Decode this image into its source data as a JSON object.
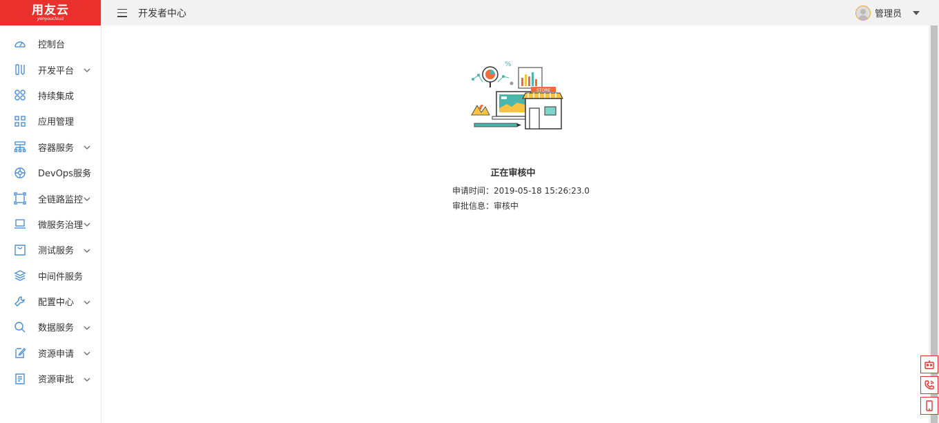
{
  "logo": {
    "main": "用友云",
    "sub": "yonyoucloud"
  },
  "header": {
    "title": "开发者中心",
    "user_name": "管理员"
  },
  "sidebar": {
    "items": [
      {
        "label": "控制台",
        "icon": "dashboard-icon",
        "expandable": false
      },
      {
        "label": "开发平台",
        "icon": "dev-platform-icon",
        "expandable": true
      },
      {
        "label": "持续集成",
        "icon": "integration-icon",
        "expandable": false
      },
      {
        "label": "应用管理",
        "icon": "apps-grid-icon",
        "expandable": false
      },
      {
        "label": "容器服务",
        "icon": "container-tree-icon",
        "expandable": true
      },
      {
        "label": "DevOps服务",
        "icon": "devops-icon",
        "expandable": true
      },
      {
        "label": "全链路监控",
        "icon": "monitor-frame-icon",
        "expandable": true
      },
      {
        "label": "微服务治理",
        "icon": "laptop-icon",
        "expandable": true
      },
      {
        "label": "测试服务",
        "icon": "test-bag-icon",
        "expandable": true
      },
      {
        "label": "中间件服务",
        "icon": "layers-icon",
        "expandable": false
      },
      {
        "label": "配置中心",
        "icon": "wrench-icon",
        "expandable": true
      },
      {
        "label": "数据服务",
        "icon": "search-data-icon",
        "expandable": true
      },
      {
        "label": "资源申请",
        "icon": "request-edit-icon",
        "expandable": true
      },
      {
        "label": "资源审批",
        "icon": "approval-doc-icon",
        "expandable": true
      }
    ]
  },
  "status": {
    "title": "正在审核中",
    "apply_time_label": "申请时间：",
    "apply_time_value": "2019-05-18 15:26:23.0",
    "approval_info_label": "审批信息：",
    "approval_info_value": "审核中"
  },
  "illustration": {
    "store_label": "STORE"
  },
  "colors": {
    "brand": "#e9302c",
    "icon_blue": "#4a8fd9",
    "header_bg": "#f2f2f2"
  }
}
